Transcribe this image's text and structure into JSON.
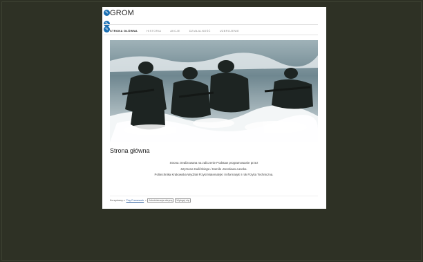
{
  "site": {
    "title": "GROM"
  },
  "nav": {
    "items": [
      {
        "label": "STRONA GŁÓWNA",
        "active": true
      },
      {
        "label": "HISTORIA",
        "active": false
      },
      {
        "label": "AKCJE",
        "active": false
      },
      {
        "label": "DZIAŁALNOŚĆ",
        "active": false
      },
      {
        "label": "UZBROJENIE",
        "active": false
      }
    ]
  },
  "hero": {
    "image": "soldiers-in-surf-photo"
  },
  "main": {
    "heading": "Strona główna",
    "line1": "Strona zrealizowana na zaliczenie Podstaw programowanie przez",
    "line2": "Szymona Kulińskiego i Kamila Jarosława Lasoka.",
    "line3": "Politechnika Krakowska Wydział Fizyki Matematyki i Informatyki I rok Fizyka Techniczna."
  },
  "footer": {
    "prefix": "Korzystamy z",
    "link": "Tiny Framework",
    "sep": "•",
    "admin": "Administracja witryną",
    "logout": "Wyloguj się"
  },
  "colors": {
    "background": "#2e3125",
    "accent": "#1a6fb3"
  }
}
